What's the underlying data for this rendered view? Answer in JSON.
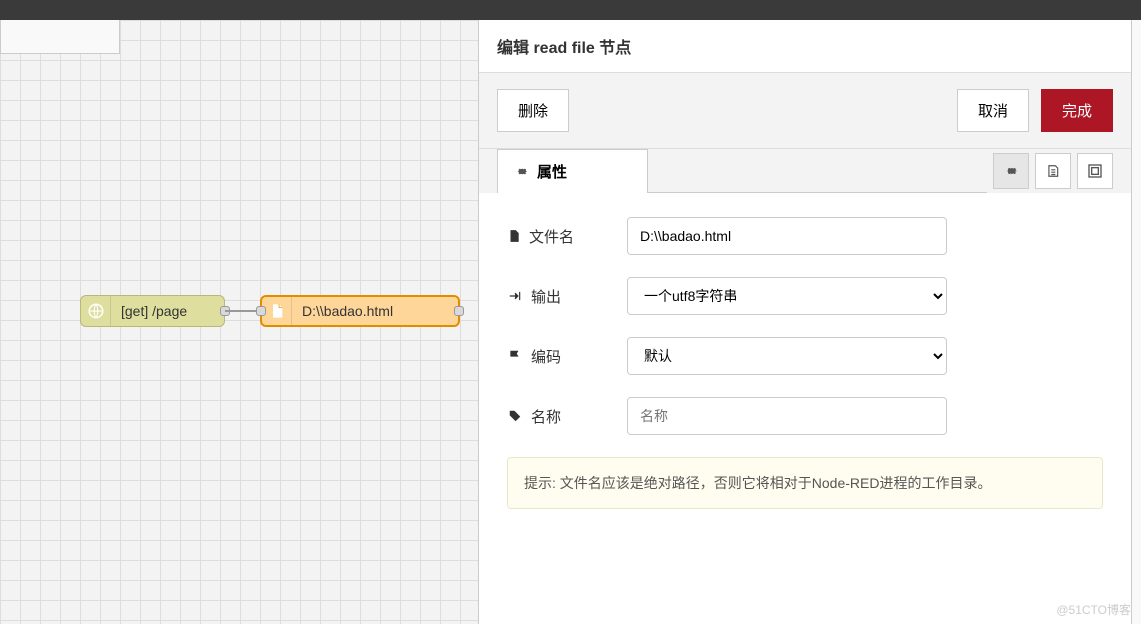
{
  "editor": {
    "title": "编辑 read file 节点",
    "delete_label": "删除",
    "cancel_label": "取消",
    "done_label": "完成",
    "tab_properties": "属性"
  },
  "form": {
    "filename_label": "文件名",
    "filename_value": "D:\\\\badao.html",
    "output_label": "输出",
    "output_value": "一个utf8字符串",
    "encoding_label": "编码",
    "encoding_value": "默认",
    "name_label": "名称",
    "name_placeholder": "名称",
    "hint_text": "提示: 文件名应该是绝对路径，否则它将相对于Node-RED进程的工作目录。"
  },
  "canvas": {
    "http_node_label": "[get] /page",
    "file_node_label": "D:\\\\badao.html"
  },
  "watermark": "@51CTO博客"
}
